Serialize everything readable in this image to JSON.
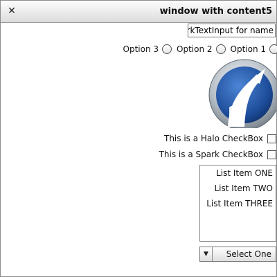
{
  "window": {
    "title": "window with content5",
    "close_glyph": "✕"
  },
  "text_input": {
    "value": "SparkTextInput for name"
  },
  "radios": [
    {
      "label": "Option 3"
    },
    {
      "label": "Option 2"
    },
    {
      "label": "Option 1"
    }
  ],
  "logo": {
    "icon": "flex-app-logo",
    "colors": {
      "ring": "#9aa3ad",
      "inner": "#1d4d9a",
      "highlight": "#ffffff"
    }
  },
  "checkboxes": {
    "halo_label": "This is a Halo CheckBox",
    "spark_label": "This is a Spark CheckBox"
  },
  "list": {
    "items": [
      "List Item ONE",
      "List Item TWO",
      "List Item THREE"
    ]
  },
  "dropdown": {
    "label": "Select One",
    "arrow": "▼"
  }
}
